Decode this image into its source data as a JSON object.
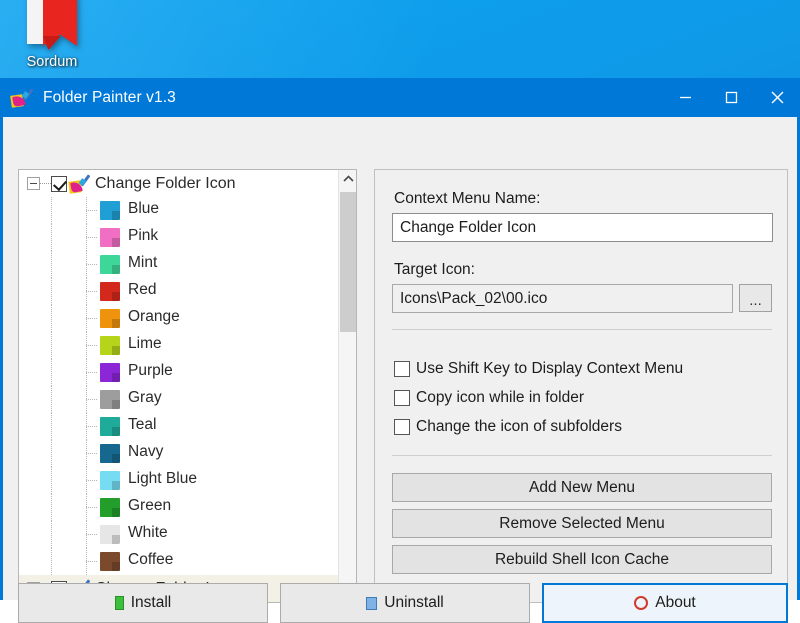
{
  "desktop": {
    "icon": {
      "name": "sordum-desktop-icon",
      "label": "Sordum"
    }
  },
  "window": {
    "title": "Folder Painter v1.3",
    "app_icon": "paint-brush-icon",
    "controls": {
      "minimize": "minimize-icon",
      "maximize": "maximize-icon",
      "close": "close-icon"
    },
    "accent_color": "#0078d7"
  },
  "tree": {
    "root": {
      "label": "Change Folder Icon",
      "checked": true,
      "expanded": true,
      "icon": "paint-brush-icon"
    },
    "children": [
      {
        "label": "Blue",
        "color": "#1f9fd4"
      },
      {
        "label": "Pink",
        "color": "#f06ec4"
      },
      {
        "label": "Mint",
        "color": "#3ed79a"
      },
      {
        "label": "Red",
        "color": "#d3291d"
      },
      {
        "label": "Orange",
        "color": "#f0930c"
      },
      {
        "label": "Lime",
        "color": "#b6d41a"
      },
      {
        "label": "Purple",
        "color": "#8b27d6"
      },
      {
        "label": "Gray",
        "color": "#9d9d9d"
      },
      {
        "label": "Teal",
        "color": "#1eab9a"
      },
      {
        "label": "Navy",
        "color": "#17688f"
      },
      {
        "label": "Light Blue",
        "color": "#76dcf2"
      },
      {
        "label": "Green",
        "color": "#239e2a"
      },
      {
        "label": "White",
        "color": "#e6e6e6"
      },
      {
        "label": "Coffee",
        "color": "#7b4a2d"
      }
    ],
    "second_root": {
      "label": "Change Folder Icon",
      "checked": true,
      "expanded": true,
      "selected": true,
      "icon": "paint-brush-icon"
    },
    "scrollbar": {
      "up": "chevron-up-icon",
      "down": "chevron-down-icon"
    }
  },
  "details": {
    "context_menu_name_label": "Context Menu Name:",
    "context_menu_name_value": "Change Folder Icon",
    "target_icon_label": "Target Icon:",
    "target_icon_value": "Icons\\Pack_02\\00.ico",
    "browse_button": "...",
    "checkboxes": [
      {
        "label": "Use Shift Key to Display Context Menu",
        "checked": false
      },
      {
        "label": "Copy icon while in folder",
        "checked": false
      },
      {
        "label": "Change the icon of subfolders",
        "checked": false
      }
    ],
    "buttons": [
      {
        "label": "Add New Menu"
      },
      {
        "label": "Remove Selected Menu"
      },
      {
        "label": "Rebuild Shell Icon Cache"
      }
    ]
  },
  "bottom_bar": {
    "buttons": [
      {
        "label": "Install",
        "icon": "green-install-icon"
      },
      {
        "label": "Uninstall",
        "icon": "blue-uninstall-icon"
      },
      {
        "label": "About",
        "icon": "red-about-icon",
        "focused": true
      }
    ]
  }
}
